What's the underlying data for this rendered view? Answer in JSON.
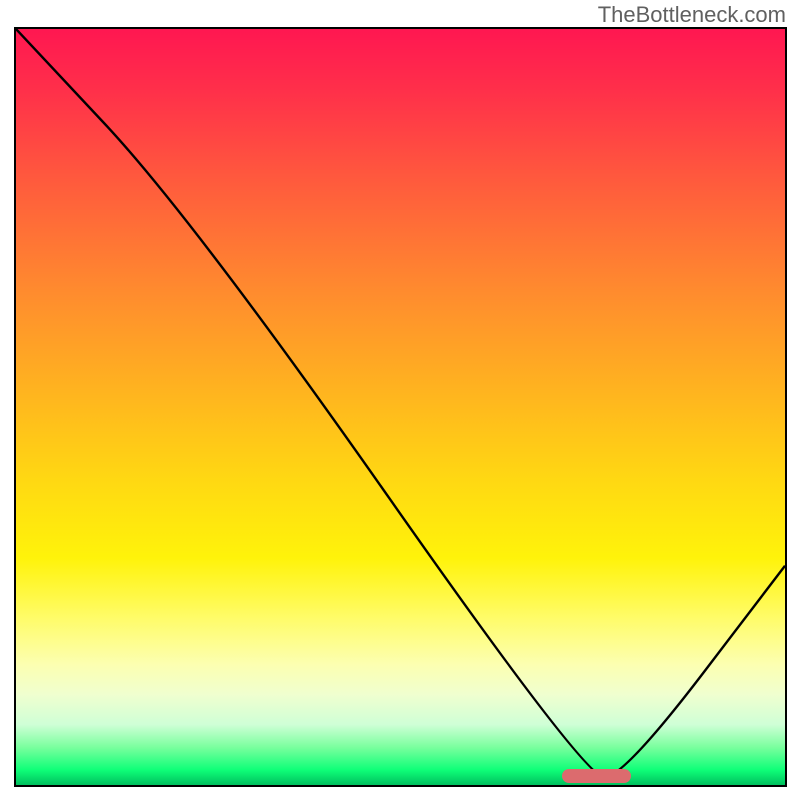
{
  "watermark": "TheBottleneck.com",
  "chart_data": {
    "type": "line",
    "title": "",
    "xlabel": "",
    "ylabel": "",
    "xlim": [
      0,
      100
    ],
    "ylim": [
      0,
      100
    ],
    "grid": false,
    "series": [
      {
        "name": "curve",
        "x": [
          0,
          23,
          74,
          79,
          100
        ],
        "y": [
          100,
          75,
          1,
          1,
          29
        ]
      }
    ],
    "marker": {
      "x_start": 71,
      "x_end": 80,
      "y": 1.2
    },
    "background_gradient": {
      "top_color": "#ff1751",
      "mid_color": "#fff30a",
      "bottom_color": "#00c05e"
    }
  },
  "frame": {
    "inner_width": 769,
    "inner_height": 756
  }
}
